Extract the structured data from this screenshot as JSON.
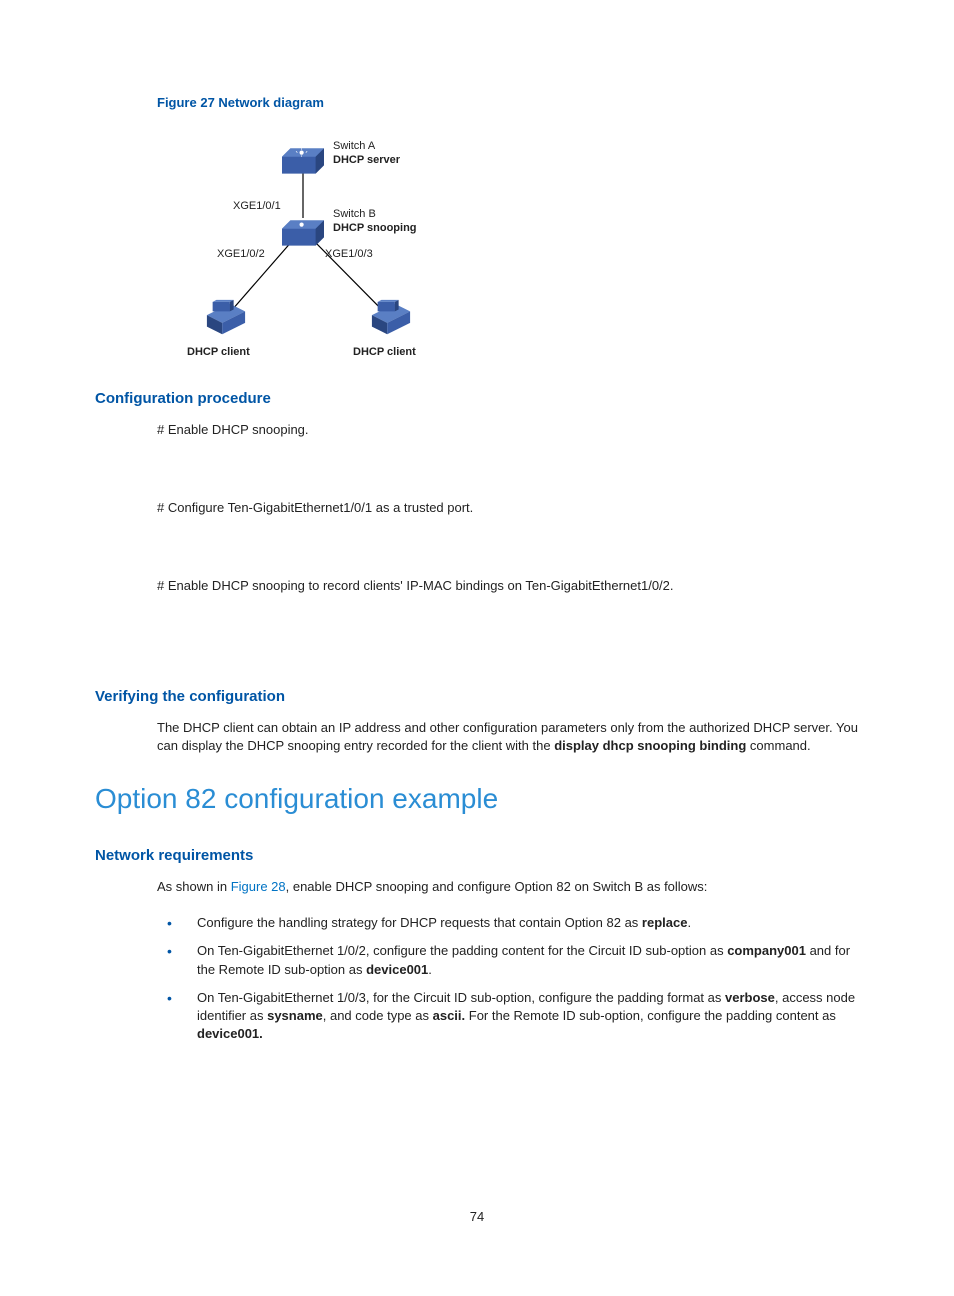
{
  "figure": {
    "caption": "Figure 27 Network diagram",
    "switchA": "Switch A",
    "dhcpServer": "DHCP server",
    "if1": "XGE1/0/1",
    "switchB": "Switch B",
    "dhcpSnoop": "DHCP snooping",
    "if2": "XGE1/0/2",
    "if3": "XGE1/0/3",
    "client1": "DHCP client",
    "client2": "DHCP client"
  },
  "h_confproc": "Configuration procedure",
  "p_snoop": "# Enable DHCP snooping.",
  "p_trust": "# Configure Ten-GigabitEthernet1/0/1 as a trusted port.",
  "p_record": "# Enable DHCP snooping to record clients' IP-MAC bindings on Ten-GigabitEthernet1/0/2.",
  "h_verify": "Verifying the configuration",
  "verify": {
    "p1a": "The DHCP client can obtain an IP address and other configuration parameters only from the authorized DHCP server. You can display the DHCP snooping entry recorded for the client with the ",
    "bold1": "display dhcp snooping binding",
    "p1b": " command."
  },
  "h_opt82": "Option 82 configuration example",
  "h_netreq": "Network requirements",
  "netreq": {
    "p1a": "As shown in ",
    "link": "Figure 28",
    "p1b": ", enable DHCP snooping and configure Option 82 on Switch B as follows:"
  },
  "b1": {
    "a": "Configure the handling strategy for DHCP requests that contain Option 82 as ",
    "bold": "replace",
    "b": "."
  },
  "b2": {
    "a": "On Ten-GigabitEthernet 1/0/2, configure the padding content for the Circuit ID sub-option as ",
    "bold1": "company001",
    "b": " and for the Remote ID sub-option as ",
    "bold2": "device001",
    "c": "."
  },
  "b3": {
    "a": "On Ten-GigabitEthernet 1/0/3, for the Circuit ID sub-option, configure the padding format as ",
    "bold1": "verbose",
    "b": ", access node identifier as ",
    "bold2": "sysname",
    "c": ", and code type as ",
    "bold3": "ascii.",
    "d": " For the Remote ID sub-option, configure the padding content as ",
    "bold4": "device001.",
    "e": ""
  },
  "pagenum": "74"
}
